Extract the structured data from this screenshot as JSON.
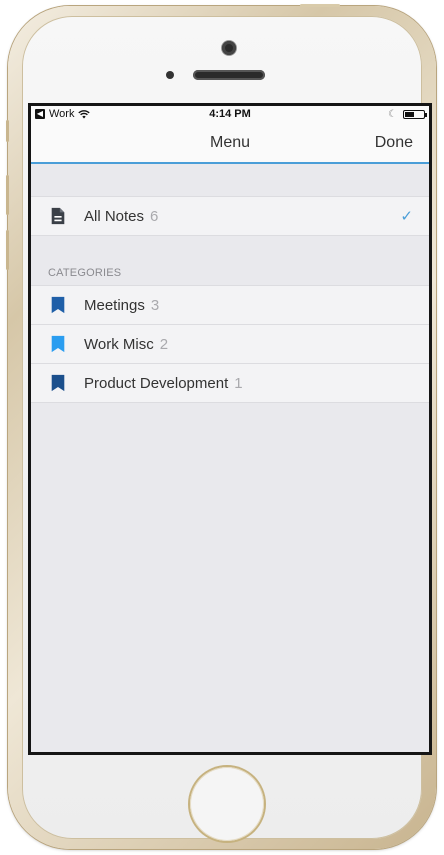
{
  "status_bar": {
    "back_app": "Work",
    "time": "4:14 PM",
    "battery_level": 0.45
  },
  "nav": {
    "title": "Menu",
    "done_label": "Done"
  },
  "all_notes": {
    "label": "All Notes",
    "count": "6",
    "selected": true,
    "icon": "document-icon"
  },
  "categories": {
    "header": "CATEGORIES",
    "items": [
      {
        "label": "Meetings",
        "count": "3",
        "color": "#1f5fa8",
        "icon": "bookmark-icon"
      },
      {
        "label": "Work Misc",
        "count": "2",
        "color": "#2a9df0",
        "icon": "bookmark-icon"
      },
      {
        "label": "Product Development",
        "count": "1",
        "color": "#1b4f8c",
        "icon": "bookmark-icon"
      }
    ]
  },
  "colors": {
    "accent": "#4a9ed8",
    "background": "#e9e9ed"
  }
}
